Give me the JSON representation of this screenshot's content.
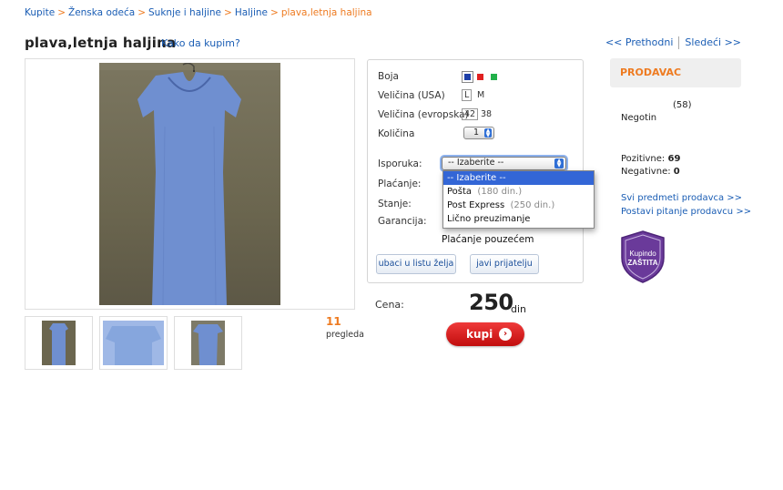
{
  "breadcrumb": {
    "items": [
      "Kupite",
      "Ženska odeća",
      "Suknje i haljine",
      "Haljine"
    ],
    "current": "plava,letnja haljina",
    "separator": ">"
  },
  "product": {
    "title": "plava,letnja haljina",
    "how_to_buy": "Kako da kupim?",
    "views_count": "11",
    "views_label": "pregleda"
  },
  "pager": {
    "prev": "<< Prethodni",
    "next": "Sledeći >>"
  },
  "options": {
    "color_label": "Boja",
    "colors": [
      "#1e3fa8",
      "#e02020",
      "#22b04a"
    ],
    "size_us_label": "Veličina (USA)",
    "size_us_selected": "L",
    "size_us_other": "M",
    "size_eu_label": "Veličina (evropska)",
    "size_eu_selected": "42",
    "size_eu_other": "38",
    "qty_label": "Količina",
    "qty_value": "1",
    "delivery_label": "Isporuka:",
    "delivery_value": "-- Izaberite --",
    "delivery_options": [
      {
        "label": "-- Izaberite --",
        "note": ""
      },
      {
        "label": "Pošta",
        "note": "(180 din.)"
      },
      {
        "label": "Post Express",
        "note": "(250 din.)"
      },
      {
        "label": "Lično preuzimanje",
        "note": ""
      }
    ],
    "payment_label": "Plaćanje:",
    "condition_label": "Stanje:",
    "warranty_label": "Garancija:",
    "payment_value": "Plaćanje pouzećem",
    "wishlist_button": "ubaci u listu želja",
    "tell_friend_button": "javi prijatelju"
  },
  "price": {
    "label": "Cena:",
    "amount": "250",
    "currency": "din",
    "buy_button": "kupi"
  },
  "seller": {
    "heading": "PRODAVAC",
    "rating_count": "(58)",
    "city": "Negotin",
    "positive_label": "Pozitivne:",
    "positive_value": "69",
    "negative_label": "Negativne:",
    "negative_value": "0",
    "all_items_link": "Svi predmeti prodavca >>",
    "ask_link": "Postavi pitanje prodavcu >>",
    "badge_line1": "Kupindo",
    "badge_line2": "ZAŠTITA"
  },
  "colors": {
    "accent": "#ee7b21",
    "link": "#1a5db4",
    "buy": "#d41414",
    "badge": "#6a3a9a"
  }
}
